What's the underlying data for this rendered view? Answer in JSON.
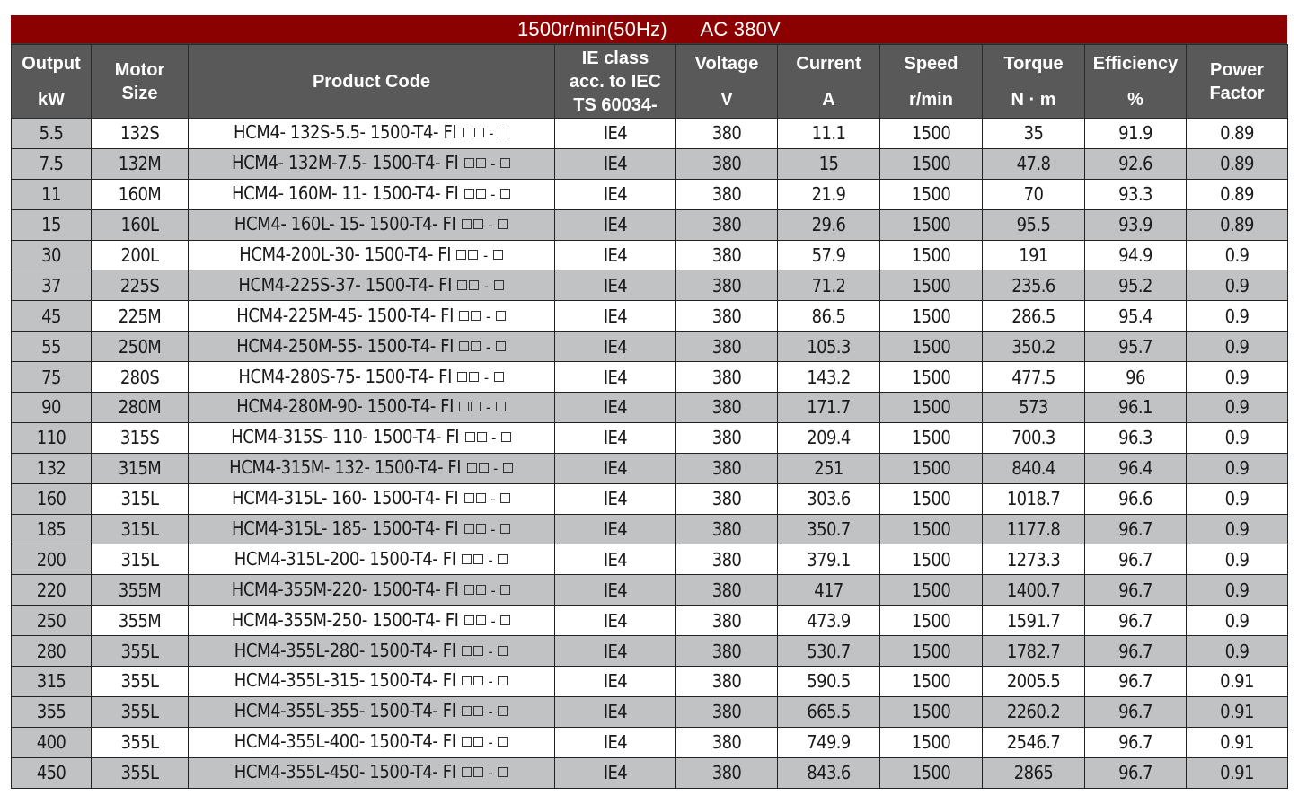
{
  "banner": {
    "speed_text": "1500r/min(50Hz)",
    "voltage_text": "AC 380V",
    "color": "#8b0000"
  },
  "header": {
    "output": [
      "Output",
      "kW"
    ],
    "motor_size": [
      "Motor",
      "Size"
    ],
    "product_code": "Product Code",
    "ie_class": [
      "IE class",
      "acc. to IEC",
      "TS 60034-"
    ],
    "voltage": [
      "Voltage",
      "V"
    ],
    "current": [
      "Current",
      "A"
    ],
    "speed": [
      "Speed",
      "r/min"
    ],
    "torque": [
      "Torque",
      "N · m"
    ],
    "efficiency": [
      "Efficiency",
      "%"
    ],
    "power_factor": [
      "Power",
      "Factor"
    ],
    "background": "#595959"
  },
  "code_suffix": "□□ - □",
  "rows": [
    {
      "kw": "5.5",
      "size": "132S",
      "code": "HCM4- 132S-5.5- 1500-T4- FI",
      "ie": "IE4",
      "v": "380",
      "a": "11.1",
      "rpm": "1500",
      "nm": "35",
      "eff": "91.9",
      "pf": "0.89"
    },
    {
      "kw": "7.5",
      "size": "132M",
      "code": "HCM4- 132M-7.5- 1500-T4- FI",
      "ie": "IE4",
      "v": "380",
      "a": "15",
      "rpm": "1500",
      "nm": "47.8",
      "eff": "92.6",
      "pf": "0.89"
    },
    {
      "kw": "11",
      "size": "160M",
      "code": "HCM4- 160M- 11- 1500-T4- FI",
      "ie": "IE4",
      "v": "380",
      "a": "21.9",
      "rpm": "1500",
      "nm": "70",
      "eff": "93.3",
      "pf": "0.89"
    },
    {
      "kw": "15",
      "size": "160L",
      "code": "HCM4- 160L- 15- 1500-T4- FI",
      "ie": "IE4",
      "v": "380",
      "a": "29.6",
      "rpm": "1500",
      "nm": "95.5",
      "eff": "93.9",
      "pf": "0.89"
    },
    {
      "kw": "30",
      "size": "200L",
      "code": "HCM4-200L-30- 1500-T4- FI",
      "ie": "IE4",
      "v": "380",
      "a": "57.9",
      "rpm": "1500",
      "nm": "191",
      "eff": "94.9",
      "pf": "0.9"
    },
    {
      "kw": "37",
      "size": "225S",
      "code": "HCM4-225S-37- 1500-T4- FI",
      "ie": "IE4",
      "v": "380",
      "a": "71.2",
      "rpm": "1500",
      "nm": "235.6",
      "eff": "95.2",
      "pf": "0.9"
    },
    {
      "kw": "45",
      "size": "225M",
      "code": "HCM4-225M-45- 1500-T4- FI",
      "ie": "IE4",
      "v": "380",
      "a": "86.5",
      "rpm": "1500",
      "nm": "286.5",
      "eff": "95.4",
      "pf": "0.9"
    },
    {
      "kw": "55",
      "size": "250M",
      "code": "HCM4-250M-55- 1500-T4- FI",
      "ie": "IE4",
      "v": "380",
      "a": "105.3",
      "rpm": "1500",
      "nm": "350.2",
      "eff": "95.7",
      "pf": "0.9"
    },
    {
      "kw": "75",
      "size": "280S",
      "code": "HCM4-280S-75- 1500-T4- FI",
      "ie": "IE4",
      "v": "380",
      "a": "143.2",
      "rpm": "1500",
      "nm": "477.5",
      "eff": "96",
      "pf": "0.9"
    },
    {
      "kw": "90",
      "size": "280M",
      "code": "HCM4-280M-90- 1500-T4- FI",
      "ie": "IE4",
      "v": "380",
      "a": "171.7",
      "rpm": "1500",
      "nm": "573",
      "eff": "96.1",
      "pf": "0.9"
    },
    {
      "kw": "110",
      "size": "315S",
      "code": "HCM4-315S- 110- 1500-T4- FI",
      "ie": "IE4",
      "v": "380",
      "a": "209.4",
      "rpm": "1500",
      "nm": "700.3",
      "eff": "96.3",
      "pf": "0.9"
    },
    {
      "kw": "132",
      "size": "315M",
      "code": "HCM4-315M- 132- 1500-T4- FI",
      "ie": "IE4",
      "v": "380",
      "a": "251",
      "rpm": "1500",
      "nm": "840.4",
      "eff": "96.4",
      "pf": "0.9"
    },
    {
      "kw": "160",
      "size": "315L",
      "code": "HCM4-315L- 160- 1500-T4- FI",
      "ie": "IE4",
      "v": "380",
      "a": "303.6",
      "rpm": "1500",
      "nm": "1018.7",
      "eff": "96.6",
      "pf": "0.9"
    },
    {
      "kw": "185",
      "size": "315L",
      "code": "HCM4-315L- 185- 1500-T4- FI",
      "ie": "IE4",
      "v": "380",
      "a": "350.7",
      "rpm": "1500",
      "nm": "1177.8",
      "eff": "96.7",
      "pf": "0.9"
    },
    {
      "kw": "200",
      "size": "315L",
      "code": "HCM4-315L-200- 1500-T4- FI",
      "ie": "IE4",
      "v": "380",
      "a": "379.1",
      "rpm": "1500",
      "nm": "1273.3",
      "eff": "96.7",
      "pf": "0.9"
    },
    {
      "kw": "220",
      "size": "355M",
      "code": "HCM4-355M-220- 1500-T4- FI",
      "ie": "IE4",
      "v": "380",
      "a": "417",
      "rpm": "1500",
      "nm": "1400.7",
      "eff": "96.7",
      "pf": "0.9"
    },
    {
      "kw": "250",
      "size": "355M",
      "code": "HCM4-355M-250- 1500-T4- FI",
      "ie": "IE4",
      "v": "380",
      "a": "473.9",
      "rpm": "1500",
      "nm": "1591.7",
      "eff": "96.7",
      "pf": "0.9"
    },
    {
      "kw": "280",
      "size": "355L",
      "code": "HCM4-355L-280- 1500-T4- FI",
      "ie": "IE4",
      "v": "380",
      "a": "530.7",
      "rpm": "1500",
      "nm": "1782.7",
      "eff": "96.7",
      "pf": "0.9"
    },
    {
      "kw": "315",
      "size": "355L",
      "code": "HCM4-355L-315- 1500-T4- FI",
      "ie": "IE4",
      "v": "380",
      "a": "590.5",
      "rpm": "1500",
      "nm": "2005.5",
      "eff": "96.7",
      "pf": "0.91"
    },
    {
      "kw": "355",
      "size": "355L",
      "code": "HCM4-355L-355- 1500-T4- FI",
      "ie": "IE4",
      "v": "380",
      "a": "665.5",
      "rpm": "1500",
      "nm": "2260.2",
      "eff": "96.7",
      "pf": "0.91"
    },
    {
      "kw": "400",
      "size": "355L",
      "code": "HCM4-355L-400- 1500-T4- FI",
      "ie": "IE4",
      "v": "380",
      "a": "749.9",
      "rpm": "1500",
      "nm": "2546.7",
      "eff": "96.7",
      "pf": "0.91"
    },
    {
      "kw": "450",
      "size": "355L",
      "code": "HCM4-355L-450- 1500-T4- FI",
      "ie": "IE4",
      "v": "380",
      "a": "843.6",
      "rpm": "1500",
      "nm": "2865",
      "eff": "96.7",
      "pf": "0.91"
    }
  ]
}
